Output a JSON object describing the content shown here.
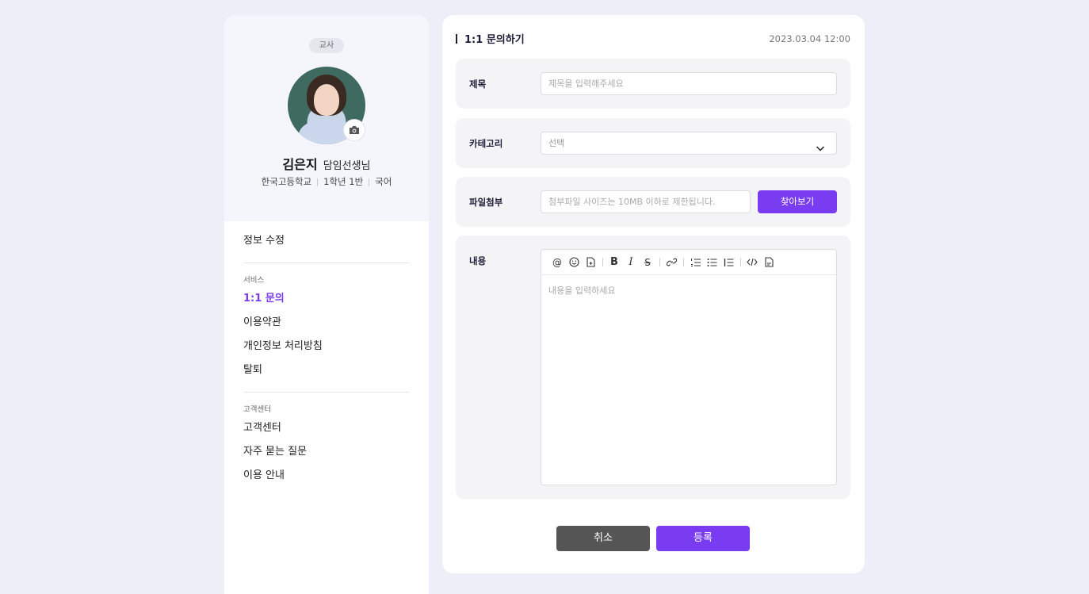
{
  "profile": {
    "role_badge": "교사",
    "name": "김은지",
    "title": "담임선생님",
    "school": "한국고등학교",
    "class": "1학년 1반",
    "subject": "국어"
  },
  "menu": {
    "edit_info": "정보 수정",
    "service_section": "서비스",
    "service_items": [
      "1:1 문의",
      "이용약관",
      "개인정보 처리방침",
      "탈퇴"
    ],
    "support_section": "고객센터",
    "support_items": [
      "고객센터",
      "자주 묻는 질문",
      "이용 안내"
    ]
  },
  "form": {
    "title": "1:1 문의하기",
    "date": "2023.03.04 12:00",
    "subject_label": "제목",
    "subject_placeholder": "제목을 입력해주세요",
    "category_label": "카테고리",
    "category_value": "선택",
    "file_label": "파일첨부",
    "file_placeholder": "첨부파일 사이즈는 10MB 이하로 제한됩니다.",
    "browse_button": "찾아보기",
    "content_label": "내용",
    "content_placeholder": "내용을 입력하세요",
    "toolbar_icons": [
      "mention-icon",
      "emoji-icon",
      "file-icon",
      "bold-icon",
      "italic-icon",
      "strikethrough-icon",
      "link-icon",
      "ordered-list-icon",
      "bullet-list-icon",
      "blockquote-icon",
      "code-icon",
      "document-icon"
    ],
    "cancel_button": "취소",
    "submit_button": "등록"
  },
  "colors": {
    "accent": "#7a3cf0",
    "background": "#eceef8",
    "cancel": "#555555"
  }
}
